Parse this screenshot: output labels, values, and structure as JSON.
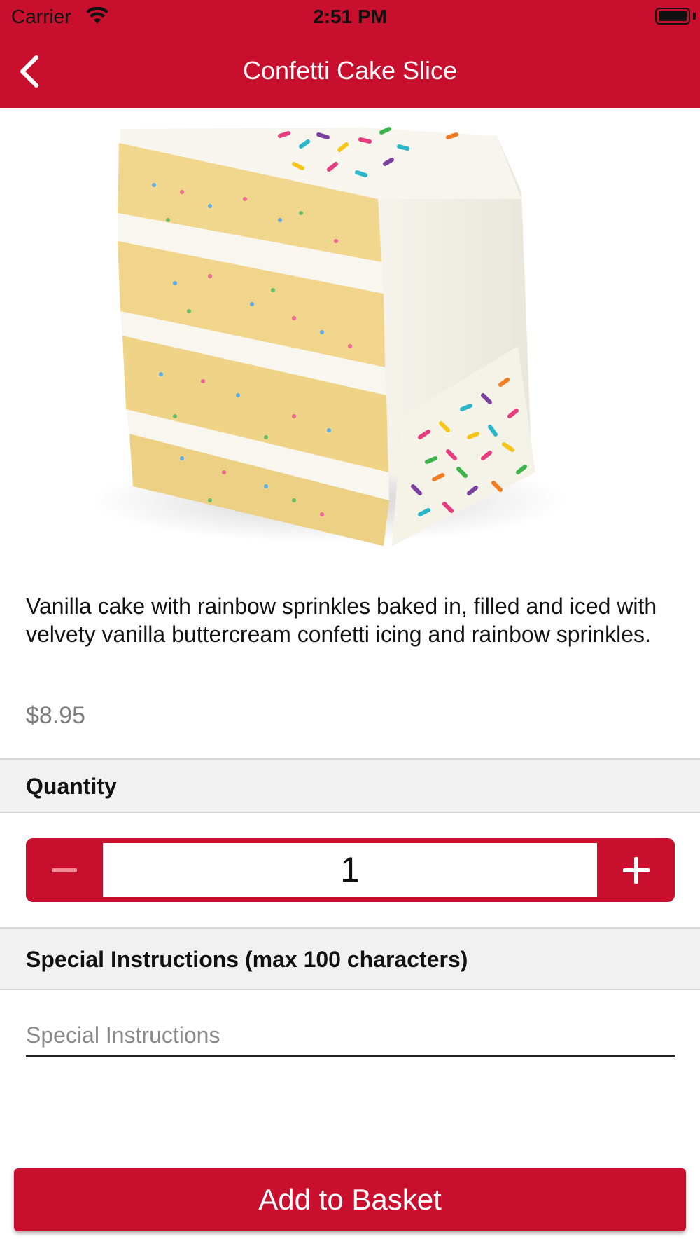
{
  "status_bar": {
    "carrier": "Carrier",
    "time": "2:51 PM",
    "wifi_icon": "wifi-icon",
    "battery_icon": "battery-icon"
  },
  "nav": {
    "title": "Confetti Cake Slice",
    "back_icon": "chevron-left-icon",
    "background_color": "#c8102e"
  },
  "product": {
    "image": "confetti-cake-slice-photo",
    "description": "Vanilla cake with rainbow sprinkles baked in, filled and iced with velvety vanilla buttercream confetti icing and rainbow sprinkles.",
    "price": "$8.95"
  },
  "quantity": {
    "header": "Quantity",
    "value": "1",
    "minus_icon": "minus-icon",
    "plus_icon": "plus-icon"
  },
  "special_instructions": {
    "header": "Special Instructions (max 100 characters)",
    "placeholder": "Special Instructions",
    "value": ""
  },
  "footer": {
    "add_button_label": "Add to Basket"
  },
  "colors": {
    "accent": "#c8102e",
    "section_bg": "#f1f1f1",
    "muted_text": "#7d7d7d"
  }
}
